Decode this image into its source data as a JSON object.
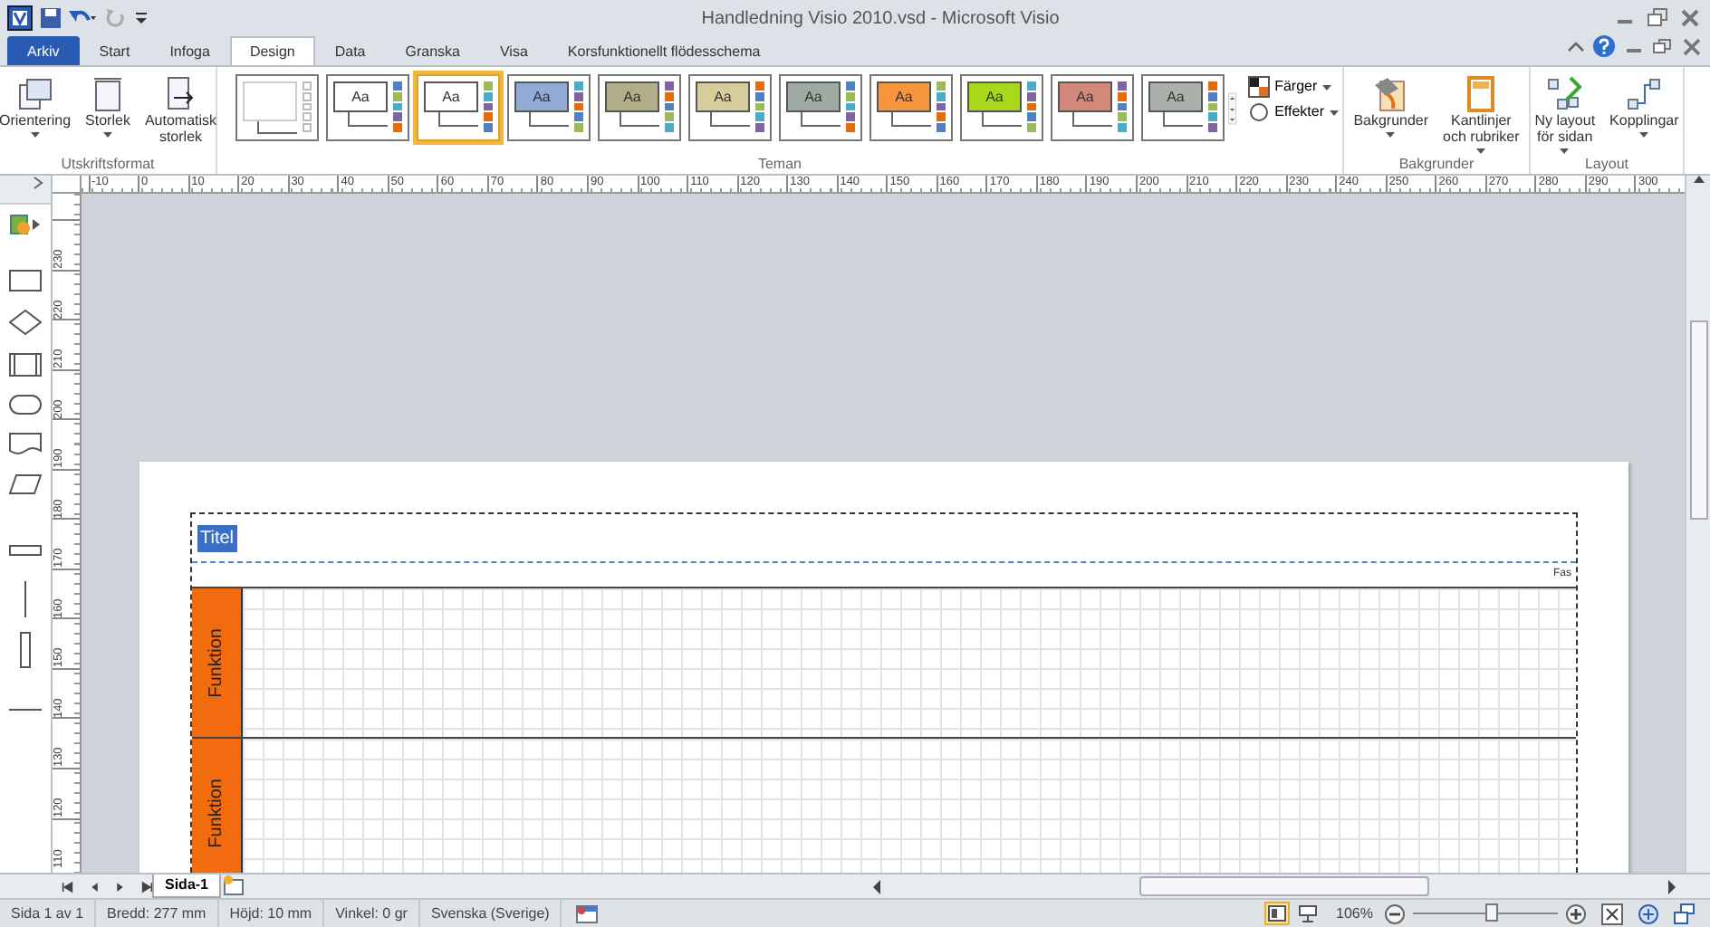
{
  "window": {
    "title": "Handledning Visio 2010.vsd - Microsoft Visio"
  },
  "tabs": [
    {
      "label": "Arkiv",
      "kind": "file",
      "selected": false
    },
    {
      "label": "Start",
      "kind": "tab",
      "selected": false
    },
    {
      "label": "Infoga",
      "kind": "tab",
      "selected": false
    },
    {
      "label": "Design",
      "kind": "tab",
      "selected": true
    },
    {
      "label": "Data",
      "kind": "tab",
      "selected": false
    },
    {
      "label": "Granska",
      "kind": "tab",
      "selected": false
    },
    {
      "label": "Visa",
      "kind": "tab",
      "selected": false
    },
    {
      "label": "Korsfunktionellt flödesschema",
      "kind": "tab",
      "selected": false
    }
  ],
  "ribbon": {
    "page_setup": {
      "label": "Utskriftsformat",
      "buttons": [
        {
          "lines": [
            "Orientering"
          ],
          "kind": "orientation",
          "dropdown": true
        },
        {
          "lines": [
            "Storlek"
          ],
          "kind": "size",
          "dropdown": true
        },
        {
          "lines": [
            "Automatisk",
            "storlek"
          ],
          "kind": "autosize",
          "dropdown": false
        }
      ]
    },
    "themes": {
      "label": "Teman",
      "items": [
        {
          "kind": "blank",
          "selected": false,
          "color": "#ffffff"
        },
        {
          "kind": "theme",
          "text": "Aa",
          "selected": false,
          "color": "#ffffff"
        },
        {
          "kind": "theme",
          "text": "Aa",
          "selected": true,
          "color": "#ffffff"
        },
        {
          "kind": "theme",
          "text": "Aa",
          "selected": false,
          "color": "#8fabd6"
        },
        {
          "kind": "theme",
          "text": "Aa",
          "selected": false,
          "color": "#b3ae8a"
        },
        {
          "kind": "theme",
          "text": "Aa",
          "selected": false,
          "color": "#d8cc9c"
        },
        {
          "kind": "theme",
          "text": "Aa",
          "selected": false,
          "color": "#9eaba3"
        },
        {
          "kind": "theme",
          "text": "Aa",
          "selected": false,
          "color": "#f7963e"
        },
        {
          "kind": "theme",
          "text": "Aa",
          "selected": false,
          "color": "#a8d81c"
        },
        {
          "kind": "theme",
          "text": "Aa",
          "selected": false,
          "color": "#d2887b"
        },
        {
          "kind": "theme",
          "text": "Aa",
          "selected": false,
          "color": "#a9b1aa"
        }
      ],
      "side_buttons": [
        {
          "label": "Färger",
          "kind": "colors"
        },
        {
          "label": "Effekter",
          "kind": "effects"
        }
      ]
    },
    "backgrounds": {
      "label": "Bakgrunder",
      "buttons": [
        {
          "lines": [
            "Bakgrunder"
          ],
          "kind": "backgrounds",
          "dropdown": true
        },
        {
          "lines": [
            "Kantlinjer",
            "och rubriker"
          ],
          "kind": "borders",
          "dropdown": true
        }
      ]
    },
    "layout": {
      "label": "Layout",
      "buttons": [
        {
          "lines": [
            "Ny layout",
            "för sidan"
          ],
          "kind": "relayout",
          "dropdown": true
        },
        {
          "lines": [
            "Kopplingar"
          ],
          "kind": "connectors",
          "dropdown": true
        }
      ]
    }
  },
  "ruler": {
    "labels": [
      "-10",
      "0",
      "10",
      "20",
      "30",
      "40",
      "50",
      "60",
      "70",
      "80",
      "90",
      "100",
      "110",
      "120",
      "130",
      "140",
      "150",
      "160",
      "170",
      "180",
      "190",
      "200",
      "210",
      "220",
      "230",
      "240",
      "250",
      "260",
      "270",
      "280",
      "290",
      "300"
    ]
  },
  "vertical_ruler": {
    "labels": [
      "230",
      "220",
      "210",
      "200",
      "190",
      "180",
      "170",
      "160",
      "150",
      "140",
      "130",
      "120",
      "110"
    ]
  },
  "stencil": {
    "shapes": [
      {
        "kind": "rectangle"
      },
      {
        "kind": "diamond"
      },
      {
        "kind": "process"
      },
      {
        "kind": "rounded"
      },
      {
        "kind": "document"
      },
      {
        "kind": "parallelogram"
      },
      {
        "kind": "hbar"
      },
      {
        "kind": "vline"
      },
      {
        "kind": "vbar"
      },
      {
        "kind": "hline"
      }
    ]
  },
  "diagram": {
    "title": "Titel",
    "title_selected": true,
    "phase_label": "Fas",
    "lanes": [
      {
        "label": "Funktion"
      },
      {
        "label": "Funktion"
      }
    ]
  },
  "page_tabs": [
    {
      "label": "Sida-1",
      "selected": true
    }
  ],
  "status_bar": {
    "items": [
      "Sida 1 av 1",
      "Bredd: 277 mm",
      "Höjd: 10 mm",
      "Vinkel: 0 gr",
      "Svenska (Sverige)"
    ],
    "view_buttons": [
      {
        "kind": "normal",
        "selected": true
      },
      {
        "kind": "presentation",
        "selected": false
      }
    ],
    "zoom": {
      "label": "106%",
      "level": 0.54
    }
  }
}
